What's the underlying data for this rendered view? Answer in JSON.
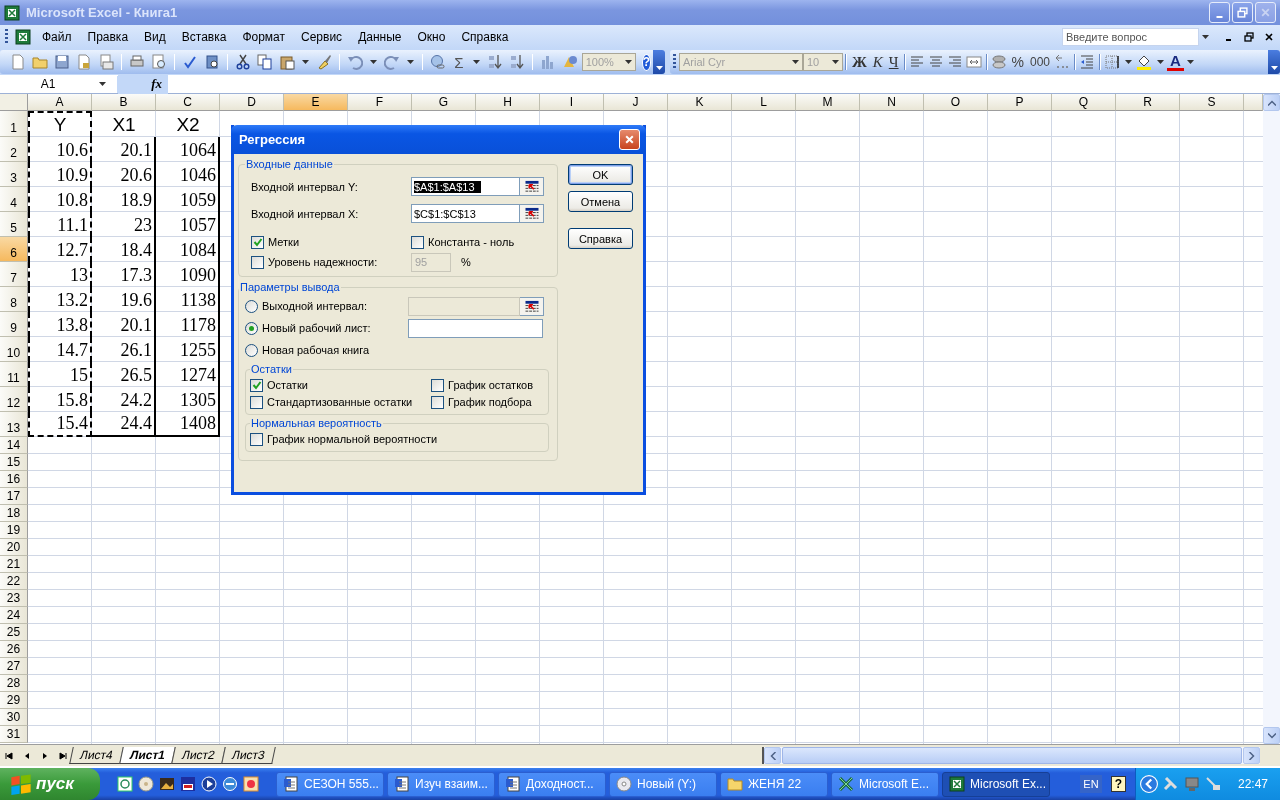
{
  "window": {
    "title": "Microsoft Excel - Книга1"
  },
  "menu": [
    "Файл",
    "Правка",
    "Вид",
    "Вставка",
    "Формат",
    "Сервис",
    "Данные",
    "Окно",
    "Справка"
  ],
  "help_box": {
    "placeholder": "Введите вопрос"
  },
  "standard_toolbar": {
    "sum": "Σ",
    "zoom": {
      "value": "100%",
      "disabled": true
    },
    "help": "?"
  },
  "formatting_toolbar": {
    "font": {
      "value": "Arial Cyr",
      "disabled": true
    },
    "size": {
      "value": "10",
      "disabled": true
    },
    "bold": "Ж",
    "italic": "К",
    "underline": "Ч",
    "percent": "%",
    "thousands": "000",
    "font_color": "A"
  },
  "formula_bar": {
    "name_box": "A1",
    "fx": "fx"
  },
  "sheet": {
    "columns": [
      {
        "label": "A",
        "selected": false
      },
      {
        "label": "B",
        "selected": false
      },
      {
        "label": "C",
        "selected": false
      },
      {
        "label": "D",
        "selected": false
      },
      {
        "label": "E",
        "selected": true
      },
      {
        "label": "F",
        "selected": false
      },
      {
        "label": "G",
        "selected": false
      },
      {
        "label": "H",
        "selected": false
      },
      {
        "label": "I",
        "selected": false
      },
      {
        "label": "J",
        "selected": false
      },
      {
        "label": "K",
        "selected": false
      },
      {
        "label": "L",
        "selected": false
      },
      {
        "label": "M",
        "selected": false
      },
      {
        "label": "N",
        "selected": false
      },
      {
        "label": "O",
        "selected": false
      },
      {
        "label": "P",
        "selected": false
      },
      {
        "label": "Q",
        "selected": false
      },
      {
        "label": "R",
        "selected": false
      },
      {
        "label": "S",
        "selected": false
      }
    ],
    "rows": [
      {
        "label": "1",
        "selected": false,
        "cells": [
          "Y",
          "X1",
          "X2"
        ]
      },
      {
        "label": "2",
        "selected": false,
        "cells": [
          "10.6",
          "20.1",
          "1064"
        ]
      },
      {
        "label": "3",
        "selected": false,
        "cells": [
          "10.9",
          "20.6",
          "1046"
        ]
      },
      {
        "label": "4",
        "selected": false,
        "cells": [
          "10.8",
          "18.9",
          "1059"
        ]
      },
      {
        "label": "5",
        "selected": false,
        "cells": [
          "11.1",
          "23",
          "1057"
        ]
      },
      {
        "label": "6",
        "selected": true,
        "cells": [
          "12.7",
          "18.4",
          "1084"
        ]
      },
      {
        "label": "7",
        "selected": false,
        "cells": [
          "13",
          "17.3",
          "1090"
        ]
      },
      {
        "label": "8",
        "selected": false,
        "cells": [
          "13.2",
          "19.6",
          "1138"
        ]
      },
      {
        "label": "9",
        "selected": false,
        "cells": [
          "13.8",
          "20.1",
          "1178"
        ]
      },
      {
        "label": "10",
        "selected": false,
        "cells": [
          "14.7",
          "26.1",
          "1255"
        ]
      },
      {
        "label": "11",
        "selected": false,
        "cells": [
          "15",
          "26.5",
          "1274"
        ]
      },
      {
        "label": "12",
        "selected": false,
        "cells": [
          "15.8",
          "24.2",
          "1305"
        ]
      },
      {
        "label": "13",
        "selected": false,
        "cells": [
          "15.4",
          "24.4",
          "1408"
        ]
      },
      {
        "label": "14",
        "selected": false
      },
      {
        "label": "15",
        "selected": false
      },
      {
        "label": "16",
        "selected": false
      },
      {
        "label": "17",
        "selected": false
      },
      {
        "label": "18",
        "selected": false
      },
      {
        "label": "19",
        "selected": false
      },
      {
        "label": "20",
        "selected": false
      },
      {
        "label": "21",
        "selected": false
      },
      {
        "label": "22",
        "selected": false
      },
      {
        "label": "23",
        "selected": false
      },
      {
        "label": "24",
        "selected": false
      },
      {
        "label": "25",
        "selected": false
      },
      {
        "label": "26",
        "selected": false
      },
      {
        "label": "27",
        "selected": false
      },
      {
        "label": "28",
        "selected": false
      },
      {
        "label": "29",
        "selected": false
      },
      {
        "label": "30",
        "selected": false
      },
      {
        "label": "31",
        "selected": false
      }
    ]
  },
  "sheet_tabs": [
    {
      "label": "Лист4",
      "selected": false
    },
    {
      "label": "Лист1",
      "selected": true
    },
    {
      "label": "Лист2",
      "selected": false
    },
    {
      "label": "Лист3",
      "selected": false
    }
  ],
  "dialog": {
    "title": "Регрессия",
    "input_group": {
      "title": "Входные данные",
      "y_label": "Входной интервал Y:",
      "y_range": {
        "value": "$A$1:$A$13",
        "selected": true
      },
      "x_label": "Входной интервал X:",
      "x_range": {
        "value": "$C$1:$C$13",
        "selected": false
      },
      "options": [
        {
          "label": "Метки",
          "checked": true
        },
        {
          "label": "Константа - ноль",
          "checked": false
        },
        {
          "label": "Уровень надежности:",
          "checked": false
        }
      ],
      "confidence": {
        "value": "95",
        "disabled": true
      },
      "percent": "%"
    },
    "output_group": {
      "title": "Параметры вывода",
      "destinations": [
        {
          "label": "Выходной интервал:",
          "selected": false,
          "kind": "range"
        },
        {
          "label": "Новый рабочий лист:",
          "selected": true,
          "kind": "text"
        },
        {
          "label": "Новая рабочая книга",
          "selected": false,
          "kind": "none"
        }
      ],
      "residuals": {
        "title": "Остатки",
        "options": [
          {
            "label": "Остатки",
            "checked": true
          },
          {
            "label": "График остатков",
            "checked": false
          },
          {
            "label": "Стандартизованные остатки",
            "checked": false
          },
          {
            "label": "График подбора",
            "checked": false
          }
        ]
      },
      "probability": {
        "title": "Нормальная вероятность",
        "options": [
          {
            "label": "График нормальной вероятности",
            "checked": false
          }
        ]
      }
    },
    "buttons": [
      {
        "label": "OK",
        "default": true
      },
      {
        "label": "Отмена",
        "default": false
      },
      {
        "label": "Справка",
        "default": false
      }
    ]
  },
  "taskbar": {
    "start": "пуск",
    "tasks": [
      {
        "label": "СЕЗОН 555...",
        "kind": "document",
        "selected": false
      },
      {
        "label": "Изуч взаим...",
        "kind": "document",
        "selected": false
      },
      {
        "label": "Доходност...",
        "kind": "document",
        "selected": false
      },
      {
        "label": "Новый (Y:)",
        "kind": "disc",
        "selected": false
      },
      {
        "label": "ЖЕНЯ 22",
        "kind": "folder",
        "selected": false
      },
      {
        "label": "Microsoft E...",
        "kind": "excel-x",
        "selected": false
      },
      {
        "label": "Microsoft Ex...",
        "kind": "excel",
        "selected": true
      }
    ],
    "language": "EN",
    "help": "?",
    "clock": "22:47"
  }
}
